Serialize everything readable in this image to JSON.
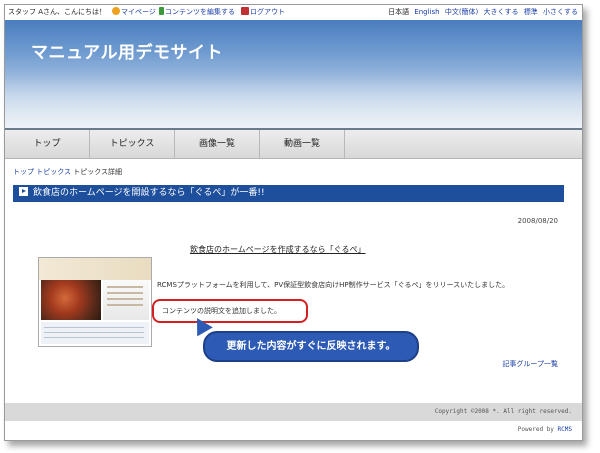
{
  "topbar": {
    "greeting": "スタッフ Aさん、こんにちは！",
    "mypage": "マイページ",
    "edit_contents": "コンテンツを編集する",
    "logout": "ログアウト",
    "lang_ja": "日本語",
    "lang_en": "English",
    "lang_zh": "中文(簡体)",
    "font_large": "大きくする",
    "font_std": "標準",
    "font_small": "小さくする"
  },
  "header": {
    "site_title": "マニュアル用デモサイト"
  },
  "nav": {
    "items": [
      "トップ",
      "トピックス",
      "画像一覧",
      "動画一覧"
    ]
  },
  "breadcrumb": {
    "top": "トップ",
    "topics": "トピックス",
    "current": "トピックス詳細"
  },
  "article": {
    "heading": "飲食店のホームページを開設するなら「ぐるぺ」が一番!!",
    "date": "2008/08/20",
    "subtitle": "飲食店のホームページを作成するなら「ぐるぺ」",
    "body": "RCMSプラットフォームを利用して、PV保証型飲食店向けHP制作サービス「ぐるぺ」をリリースいたしました。",
    "description": "コンテンツの説明文を追加しました。",
    "group_link": "記事グループ一覧"
  },
  "callout": {
    "text": "更新した内容がすぐに反映されます。"
  },
  "footer": {
    "copyright": "Copyright ©2008 *. All right reserved.",
    "powered_prefix": "Powered by",
    "powered_brand": "RCMS"
  }
}
